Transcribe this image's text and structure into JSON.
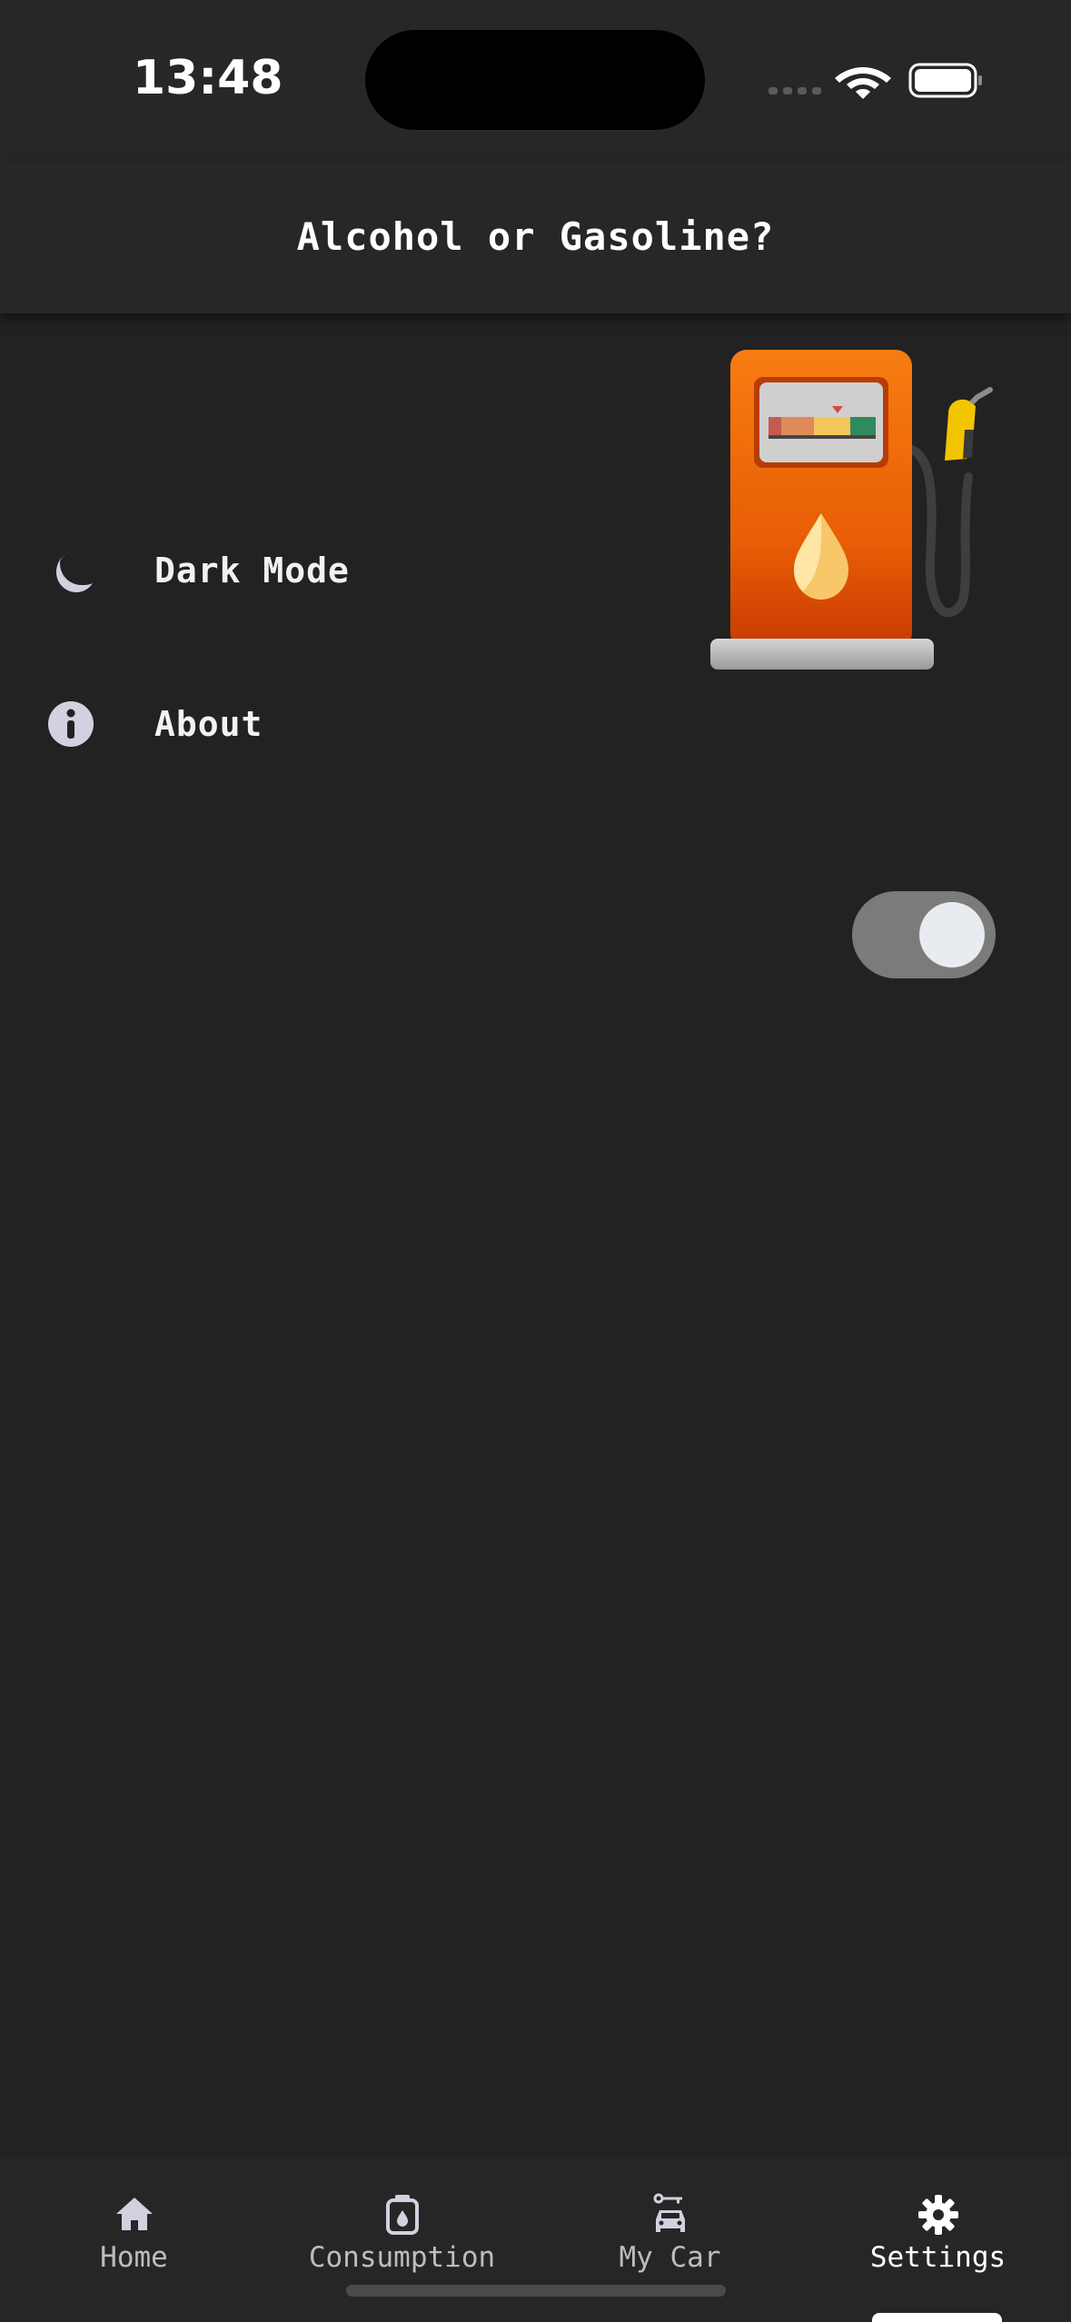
{
  "status_bar": {
    "time": "13:48"
  },
  "header": {
    "title": "Alcohol or Gasoline?"
  },
  "illustration": {
    "icon": "fuel-pump-icon"
  },
  "settings": {
    "dark_mode": {
      "label": "Dark Mode",
      "icon": "moon-icon",
      "enabled": true
    },
    "about": {
      "label": "About",
      "icon": "info-icon"
    }
  },
  "tabs": [
    {
      "label": "Home",
      "icon": "home-icon",
      "active": false
    },
    {
      "label": "Consumption",
      "icon": "fuel-can-icon",
      "active": false
    },
    {
      "label": "My Car",
      "icon": "car-icon",
      "active": false
    },
    {
      "label": "Settings",
      "icon": "gear-icon",
      "active": true
    }
  ],
  "colors": {
    "background": "#222222",
    "bar": "#272727",
    "toggle_track": "#7b7b7b",
    "accent_pump": "#f06a0a"
  }
}
